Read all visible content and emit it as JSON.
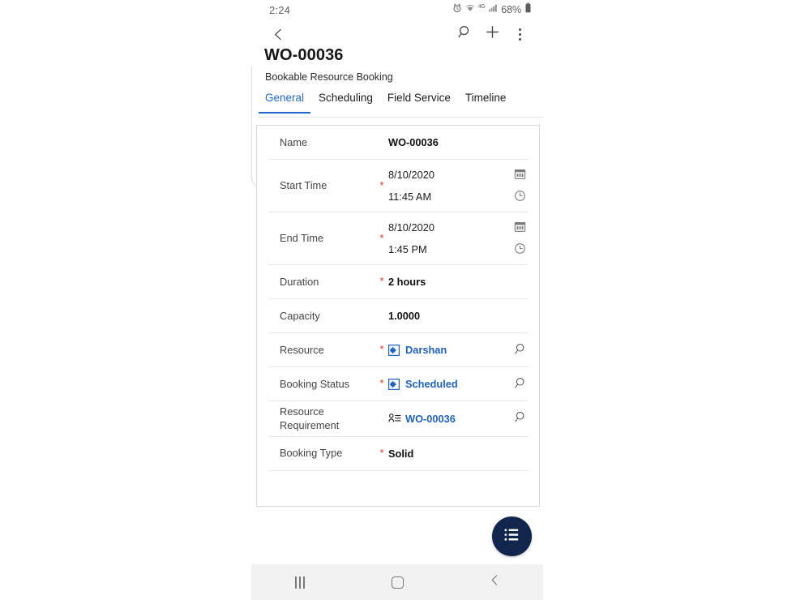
{
  "status_bar": {
    "time": "2:24",
    "battery_percent": "68%",
    "network_label": "4G",
    "icons": [
      "alarm-icon",
      "wifi-icon",
      "network-4g-icon",
      "signal-bars-icon",
      "battery-icon"
    ]
  },
  "action_bar": {
    "back_label": "Back",
    "search_label": "Search",
    "add_label": "New",
    "more_label": "More commands"
  },
  "header": {
    "title": "WO-00036",
    "subtitle": "Bookable Resource Booking"
  },
  "tabs": [
    {
      "label": "General",
      "active": true
    },
    {
      "label": "Scheduling",
      "active": false
    },
    {
      "label": "Field Service",
      "active": false
    },
    {
      "label": "Timeline",
      "active": false
    }
  ],
  "form": {
    "fields": [
      {
        "label": "Name",
        "required": false,
        "type": "text",
        "value": "WO-00036"
      },
      {
        "label": "Start Time",
        "required": true,
        "type": "datetime",
        "date": "8/10/2020",
        "time": "11:45 AM",
        "date_icon": "calendar-icon",
        "time_icon": "clock-icon"
      },
      {
        "label": "End Time",
        "required": true,
        "type": "datetime",
        "date": "8/10/2020",
        "time": "1:45 PM",
        "date_icon": "calendar-icon",
        "time_icon": "clock-icon"
      },
      {
        "label": "Duration",
        "required": true,
        "type": "text",
        "value": "2 hours"
      },
      {
        "label": "Capacity",
        "required": false,
        "type": "text",
        "value": "1.0000"
      },
      {
        "label": "Resource",
        "required": true,
        "type": "lookup",
        "value": "Darshan",
        "entity_icon": "bookable-resource-record-icon",
        "lookup_icon": "search-icon"
      },
      {
        "label": "Booking Status",
        "required": true,
        "type": "lookup",
        "value": "Scheduled",
        "entity_icon": "booking-status-record-icon",
        "lookup_icon": "search-icon"
      },
      {
        "label": "Resource Requirement",
        "required": false,
        "type": "lookup",
        "value": "WO-00036",
        "entity_icon": "resource-requirement-record-icon",
        "lookup_icon": "search-icon"
      },
      {
        "label": "Booking Type",
        "required": true,
        "type": "text",
        "value": "Solid"
      }
    ]
  },
  "fab": {
    "label": "Related records",
    "icon": "list-menu-icon",
    "color": "#12264d"
  },
  "nav_bar": {
    "recents_label": "Recents",
    "home_label": "Home",
    "back_label": "Back"
  },
  "colors": {
    "accent": "#2266cc",
    "link": "#1f61c4",
    "required": "#d03a2a",
    "fab": "#12264d",
    "navbar": "#f2f2f2"
  }
}
